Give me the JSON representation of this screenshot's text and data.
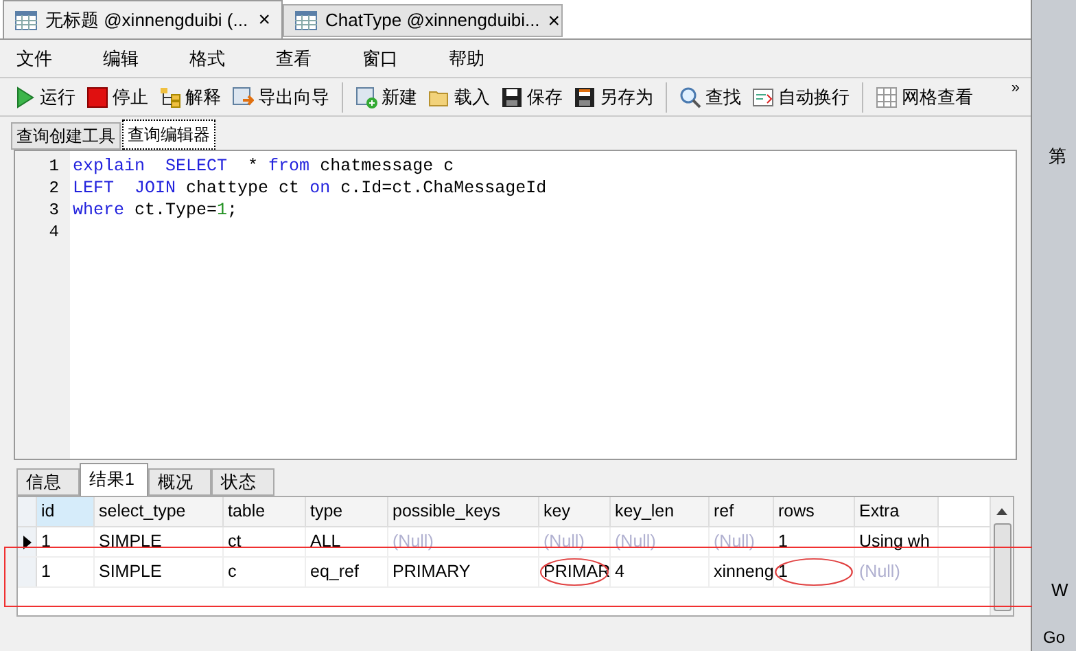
{
  "document_tabs": [
    {
      "label": "无标题 @xinnengduibi (...",
      "close": "×",
      "selected": true
    },
    {
      "label": "ChatType @xinnengduibi...",
      "close": "×",
      "selected": false
    }
  ],
  "menu": [
    "文件",
    "编辑",
    "格式",
    "查看",
    "窗口",
    "帮助"
  ],
  "toolbar": [
    {
      "kind": "run",
      "label": "运行"
    },
    {
      "kind": "stop",
      "label": "停止"
    },
    {
      "kind": "explain",
      "label": "解释"
    },
    {
      "kind": "export",
      "label": "导出向导"
    },
    {
      "kind": "separator"
    },
    {
      "kind": "new",
      "label": "新建"
    },
    {
      "kind": "open",
      "label": "载入"
    },
    {
      "kind": "save",
      "label": "保存"
    },
    {
      "kind": "saveas",
      "label": "另存为"
    },
    {
      "kind": "separator"
    },
    {
      "kind": "find",
      "label": "查找"
    },
    {
      "kind": "wrap",
      "label": "自动换行"
    },
    {
      "kind": "separator"
    },
    {
      "kind": "grid",
      "label": "网格查看"
    }
  ],
  "toolbar_overflow": "»",
  "editor_tabs": [
    {
      "label": "查询创建工具",
      "selected": false
    },
    {
      "label": "查询编辑器",
      "selected": true
    }
  ],
  "editor_lines": [
    {
      "number": "1",
      "tokens": [
        {
          "text": "explain",
          "kind": "keyword"
        },
        {
          "text": "  SELECT",
          "kind": "keyword"
        },
        {
          "text": "  * ",
          "kind": "plain"
        },
        {
          "text": "from",
          "kind": "keyword"
        },
        {
          "text": " chatmessage c",
          "kind": "plain"
        }
      ]
    },
    {
      "number": "2",
      "tokens": [
        {
          "text": "LEFT",
          "kind": "keyword"
        },
        {
          "text": "  JOIN",
          "kind": "keyword"
        },
        {
          "text": " chattype ct ",
          "kind": "plain"
        },
        {
          "text": "on",
          "kind": "keyword"
        },
        {
          "text": " c.Id=ct.ChaMessageId",
          "kind": "plain"
        }
      ]
    },
    {
      "number": "3",
      "tokens": [
        {
          "text": "where",
          "kind": "keyword"
        },
        {
          "text": " ct.Type=",
          "kind": "plain"
        },
        {
          "text": "1",
          "kind": "number"
        },
        {
          "text": ";",
          "kind": "plain"
        }
      ]
    },
    {
      "number": "4"
    }
  ],
  "result_tabs": [
    {
      "label": "信息",
      "selected": false
    },
    {
      "label": "结果1",
      "selected": true
    },
    {
      "label": "概况",
      "selected": false
    },
    {
      "label": "状态",
      "selected": false
    }
  ],
  "table": {
    "columns": [
      "id",
      "select_type",
      "table",
      "type",
      "possible_keys",
      "key",
      "key_len",
      "ref",
      "rows",
      "Extra"
    ],
    "rows": [
      {
        "current": true,
        "highlighted": false,
        "cells": [
          {
            "text": "1",
            "null": false,
            "circled": false
          },
          {
            "text": "SIMPLE",
            "null": false,
            "circled": false
          },
          {
            "text": "ct",
            "null": false,
            "circled": false
          },
          {
            "text": "ALL",
            "null": false,
            "circled": false
          },
          {
            "text": "(Null)",
            "null": true,
            "circled": false
          },
          {
            "text": "(Null)",
            "null": true,
            "circled": false
          },
          {
            "text": "(Null)",
            "null": true,
            "circled": false
          },
          {
            "text": "(Null)",
            "null": true,
            "circled": false
          },
          {
            "text": "1",
            "null": false,
            "circled": false
          },
          {
            "text": "Using wh",
            "null": false,
            "circled": false
          }
        ]
      },
      {
        "current": false,
        "highlighted": true,
        "cells": [
          {
            "text": "1",
            "null": false,
            "circled": false
          },
          {
            "text": "SIMPLE",
            "null": false,
            "circled": false
          },
          {
            "text": "c",
            "null": false,
            "circled": false
          },
          {
            "text": "eq_ref",
            "null": false,
            "circled": false
          },
          {
            "text": "PRIMARY",
            "null": false,
            "circled": false
          },
          {
            "text": "PRIMAR",
            "null": false,
            "circled": true
          },
          {
            "text": "4",
            "null": false,
            "circled": false
          },
          {
            "text": "xinneng",
            "null": false,
            "circled": false
          },
          {
            "text": "1",
            "null": false,
            "circled": true
          },
          {
            "text": "(Null)",
            "null": true,
            "circled": false
          }
        ]
      }
    ]
  },
  "background_window": {
    "texts": [
      "第",
      "W",
      "Go"
    ]
  }
}
